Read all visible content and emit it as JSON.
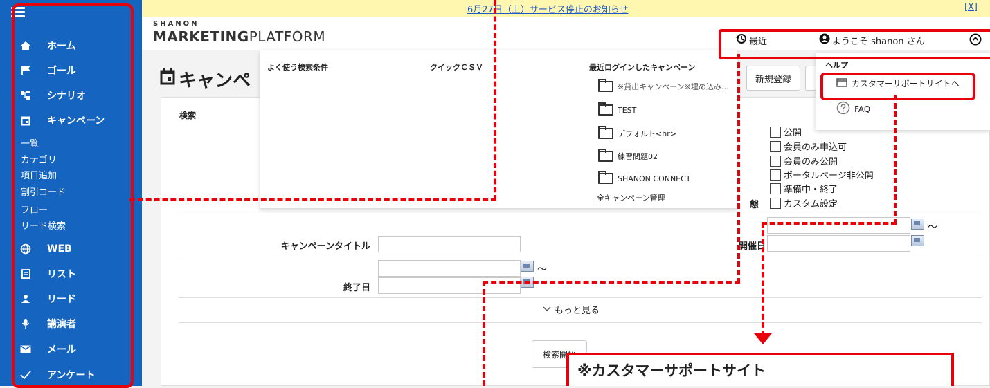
{
  "notice": {
    "text": "6月27日（土）サービス停止のお知らせ",
    "close": "[X]"
  },
  "logo": {
    "small": "SHANON",
    "big_bold": "MARKETING",
    "big_rest": "PLATFORM"
  },
  "header": {
    "recent": "最近",
    "welcome": "ようこそ shanon さん"
  },
  "sidebar": {
    "items": [
      {
        "label": "ホーム",
        "icon": "home-icon"
      },
      {
        "label": "ゴール",
        "icon": "flag-icon"
      },
      {
        "label": "シナリオ",
        "icon": "scenario-icon"
      },
      {
        "label": "キャンペーン",
        "icon": "calendar-icon"
      },
      {
        "label": "WEB",
        "icon": "globe-icon"
      },
      {
        "label": "リスト",
        "icon": "list-icon"
      },
      {
        "label": "リード",
        "icon": "person-icon"
      },
      {
        "label": "講演者",
        "icon": "mic-icon"
      },
      {
        "label": "メール",
        "icon": "mail-icon"
      },
      {
        "label": "アンケート",
        "icon": "check-icon"
      }
    ],
    "sub_items": [
      "一覧",
      "カテゴリ",
      "項目追加",
      "割引コード",
      "フロー",
      "リード検索"
    ]
  },
  "page": {
    "title": "キャンペ",
    "new_button": "新規登録"
  },
  "overlay": {
    "fav_search": "よく使う検索条件",
    "quick_csv": "クイックＣＳＶ",
    "recent_login": "最近ログインしたキャンペーン",
    "campaigns": [
      "※貸出キャンペーン※埋め込み…",
      "TEST",
      "デフォルト<hr>",
      "練習問題02",
      "SHANON CONNECT"
    ],
    "all_manage": "全キャンペーン管理"
  },
  "help": {
    "title": "ヘルプ",
    "support": "カスタマーサポートサイトへ",
    "faq": "FAQ"
  },
  "search": {
    "heading": "検索",
    "status_options": [
      "公開",
      "会員のみ申込可",
      "会員のみ公開",
      "ポータルページ非公開",
      "準備中・終了",
      "カスタム設定"
    ],
    "status_label_tail": "態",
    "campaign_title_label": "キャンペーンタイトル",
    "held_date_label": "開催日",
    "end_date_label": "終了日",
    "tilde": "～",
    "more": "もっと見る",
    "start_button": "検索開始"
  },
  "callout": {
    "text": "※カスタマーサポートサイト"
  },
  "annotation_color": "#e8000b",
  "sidebar_color": "#1565c0"
}
